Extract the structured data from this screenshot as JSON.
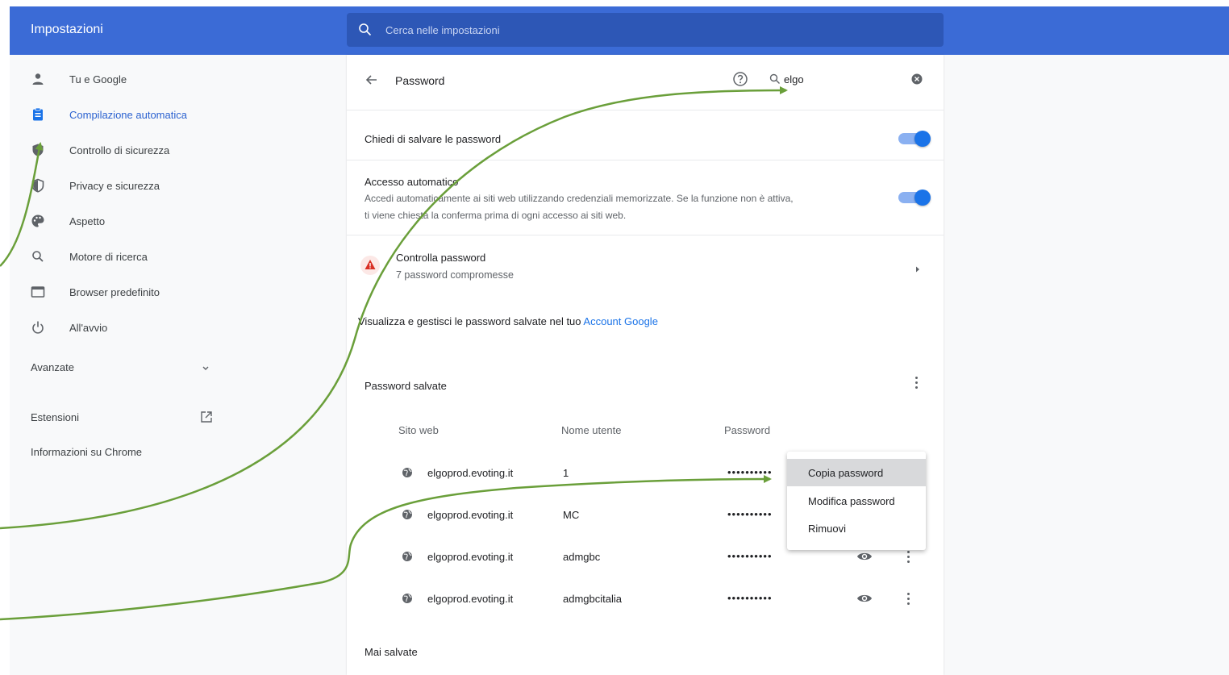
{
  "header": {
    "title": "Impostazioni",
    "search_placeholder": "Cerca nelle impostazioni"
  },
  "sidebar": {
    "items": [
      {
        "label": "Tu e Google",
        "icon": "person-icon",
        "active": false
      },
      {
        "label": "Compilazione automatica",
        "icon": "clipboard-icon",
        "active": true
      },
      {
        "label": "Controllo di sicurezza",
        "icon": "shield-icon",
        "active": false
      },
      {
        "label": "Privacy e sicurezza",
        "icon": "privacy-shield-icon",
        "active": false
      },
      {
        "label": "Aspetto",
        "icon": "palette-icon",
        "active": false
      },
      {
        "label": "Motore di ricerca",
        "icon": "search-icon",
        "active": false
      },
      {
        "label": "Browser predefinito",
        "icon": "browser-window-icon",
        "active": false
      },
      {
        "label": "All'avvio",
        "icon": "power-icon",
        "active": false
      }
    ],
    "advanced_label": "Avanzate",
    "extensions_label": "Estensioni",
    "about_label": "Informazioni su Chrome"
  },
  "password_page": {
    "title": "Password",
    "search_value": "elgo",
    "offer_to_save_label": "Chiedi di salvare le password",
    "offer_to_save_enabled": true,
    "auto_signin_title": "Accesso automatico",
    "auto_signin_desc_line1": "Accedi automaticamente ai siti web utilizzando credenziali memorizzate. Se la funzione non è attiva,",
    "auto_signin_desc_line2": "ti viene chiesta la conferma prima di ogni accesso ai siti web.",
    "auto_signin_enabled": true,
    "check_title": "Controlla password",
    "check_subtitle": "7 password compromesse",
    "manage_text": "Visualizza e gestisci le password salvate nel tuo ",
    "manage_link": "Account Google",
    "saved_section_title": "Password salvate",
    "columns": {
      "site": "Sito web",
      "username": "Nome utente",
      "password": "Password"
    },
    "rows": [
      {
        "site": "elgoprod.evoting.it",
        "username": "1",
        "password": "••••••••••"
      },
      {
        "site": "elgoprod.evoting.it",
        "username": "MC",
        "password": "••••••••••"
      },
      {
        "site": "elgoprod.evoting.it",
        "username": "admgbc",
        "password": "••••••••••"
      },
      {
        "site": "elgoprod.evoting.it",
        "username": "admgbcitalia",
        "password": "••••••••••"
      }
    ],
    "never_saved_title": "Mai salvate"
  },
  "context_menu": {
    "items": [
      "Copia password",
      "Modifica password",
      "Rimuovi"
    ],
    "highlighted": "Copia password"
  },
  "colors": {
    "header_blue": "#3b6bd6",
    "accent_blue": "#1a73e8",
    "annotation_green": "#6a9f3a",
    "warning_red": "#d93025"
  }
}
